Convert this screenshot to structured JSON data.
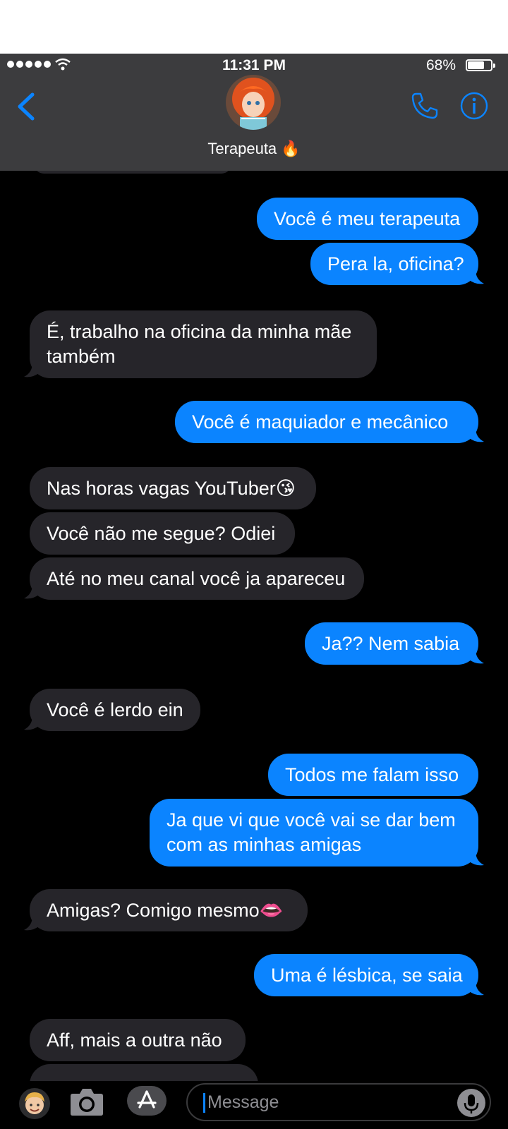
{
  "status_bar": {
    "time": "11:31 PM",
    "battery_pct": "68%",
    "battery_level": 0.68
  },
  "header": {
    "contact_name": "Terapeuta 🔥"
  },
  "messages": [
    {
      "side": "sent",
      "text": "Você é meu terapeuta"
    },
    {
      "side": "sent",
      "text": "Pera la, oficina?"
    },
    {
      "side": "recv",
      "text": "É, trabalho na oficina da minha mãe também"
    },
    {
      "side": "sent",
      "text": "Você é maquiador e mecânico"
    },
    {
      "side": "recv",
      "text": "Nas horas vagas YouTuber😘"
    },
    {
      "side": "recv",
      "text": "Você não me segue? Odiei"
    },
    {
      "side": "recv",
      "text": "Até no meu canal você ja apareceu"
    },
    {
      "side": "sent",
      "text": "Ja?? Nem sabia"
    },
    {
      "side": "recv",
      "text": "Você é lerdo ein"
    },
    {
      "side": "sent",
      "text": "Todos me falam isso"
    },
    {
      "side": "sent",
      "text": "Ja que vi que você vai se dar bem com as minhas amigas"
    },
    {
      "side": "recv",
      "text": "Amigas? Comigo mesmo👄"
    },
    {
      "side": "sent",
      "text": "Uma é lésbica, se saia"
    },
    {
      "side": "recv",
      "text": "Aff, mais a outra não"
    }
  ],
  "composer": {
    "placeholder": "Message"
  },
  "colors": {
    "sent_bubble": "#0b84ff",
    "received_bubble": "#26252a",
    "accent": "#0b84ff",
    "header_bg": "#3c3c3e"
  }
}
